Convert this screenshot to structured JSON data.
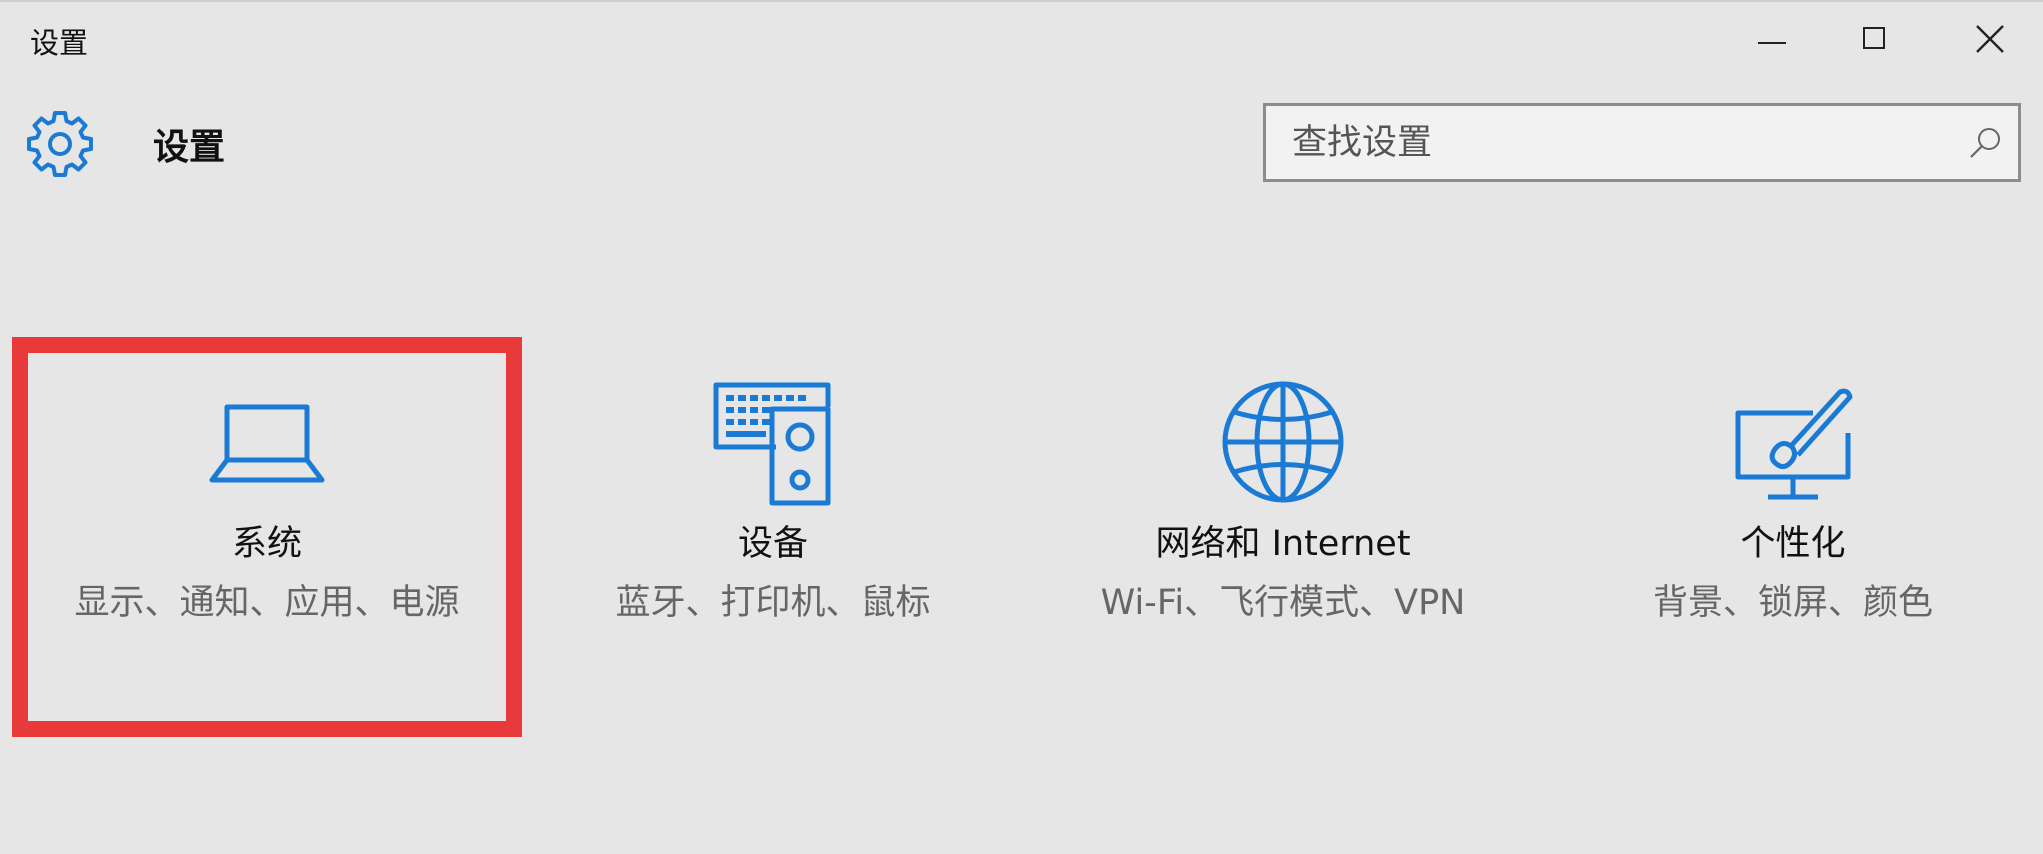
{
  "window": {
    "title": "设置"
  },
  "header": {
    "title": "设置",
    "icon": "gear-icon"
  },
  "search": {
    "placeholder": "查找设置",
    "icon": "search-icon"
  },
  "accent_color": "#1a7ad4",
  "highlight_color": "#e8393b",
  "tiles": [
    {
      "title": "系统",
      "desc": "显示、通知、应用、电源",
      "icon": "laptop-icon",
      "selected": true
    },
    {
      "title": "设备",
      "desc": "蓝牙、打印机、鼠标",
      "icon": "devices-icon"
    },
    {
      "title": "网络和 Internet",
      "desc": "Wi-Fi、飞行模式、VPN",
      "icon": "globe-icon"
    },
    {
      "title": "个性化",
      "desc": "背景、锁屏、颜色",
      "icon": "personalization-icon"
    }
  ]
}
